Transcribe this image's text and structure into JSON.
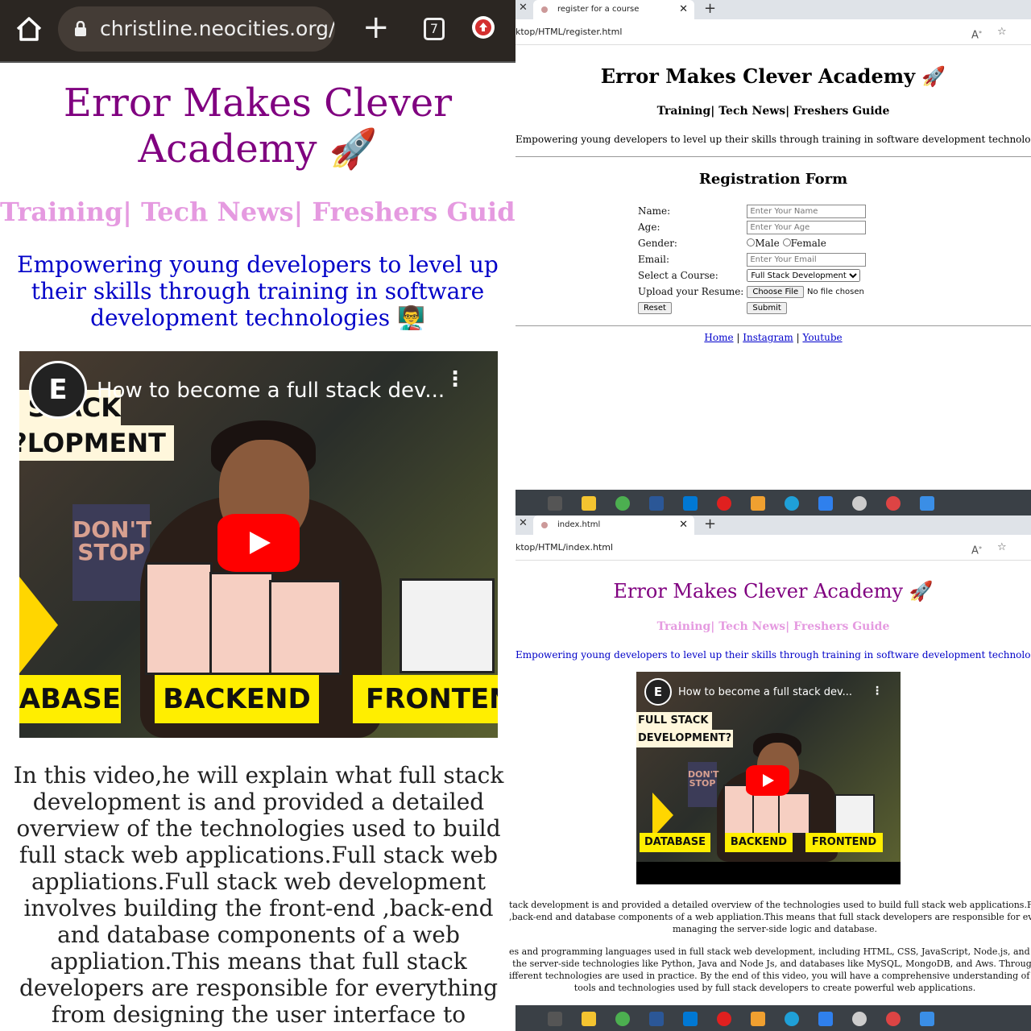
{
  "mobile": {
    "url": "christline.neocities.org/ev",
    "tab_count": "7",
    "title": "Error Makes Clever Academy 🚀",
    "nav": "Training| Tech News| Freshers Guide",
    "tagline": "Empowering young developers to level up their skills through training in software development technologies 👨‍🏫",
    "video": {
      "title": "How to become a full stack dev...",
      "caption_top": "STACK",
      "caption_bottom": "LOPMENT?",
      "labels": [
        "ABASE",
        "BACKEND",
        "FRONTEN"
      ],
      "sign": "DON'T STOP",
      "logo": "E"
    },
    "paragraph": "In this video,he will explain what full stack development is and provided a detailed overview of the technologies used to build full stack web applications.Full stack web appliations.Full stack web development involves building the front-end ,back-end and database components of a web appliation.This means that full stack developers are responsible for everything from designing the user interface to managing the server-side"
  },
  "register_window": {
    "tab_label": "register for a course",
    "address": "ktop/HTML/register.html",
    "title": "Error Makes Clever Academy 🚀",
    "nav": "Training| Tech News| Freshers Guide",
    "tagline": "Empowering young developers to level up their skills through training in software development technologies 👨‍🏫",
    "form_title": "Registration Form",
    "fields": {
      "name_label": "Name:",
      "name_placeholder": "Enter Your Name",
      "age_label": "Age:",
      "age_placeholder": "Enter Your Age",
      "gender_label": "Gender:",
      "male": "Male",
      "female": "Female",
      "email_label": "Email:",
      "email_placeholder": "Enter Your Email",
      "course_label": "Select a Course:",
      "course_value": "Full Stack Development",
      "resume_label": "Upload your Resume:",
      "choose_file": "Choose File",
      "no_file": "No file chosen",
      "reset": "Reset",
      "submit": "Submit"
    },
    "links": [
      "Home",
      "Instagram",
      "Youtube"
    ]
  },
  "index_window": {
    "tab_label": "index.html",
    "address": "ktop/HTML/index.html",
    "title": "Error Makes Clever Academy 🚀",
    "nav": "Training| Tech News| Freshers Guide",
    "tagline": "Empowering young developers to level up their skills through training in software development technologies 👨‍🏫",
    "video": {
      "title": "How to become a full stack dev...",
      "caption_top": "FULL STACK",
      "caption_bottom": "DEVELOPMENT?",
      "labels": [
        "DATABASE",
        "BACKEND",
        "FRONTEND"
      ],
      "sign": "DON'T STOP",
      "logo": "E"
    },
    "paragraph_lines": [
      "tack development is and provided a detailed overview of the technologies used to build full stack web applications.Full",
      ",back-end and database components of a web appliation.This means that full stack developers are responsible for every",
      "managing the server-side logic and database.",
      "es and programming languages used in full stack web development, including HTML, CSS, JavaScript, Node.js, and va",
      "the server-side technologies like Python, Java and Node Js, and databases like MySQL, MongoDB, and Aws. Through",
      "ifferent technologies are used in practice. By the end of this video, you will have a comprehensive understanding of wh",
      "tools and technologies used by full stack developers to create powerful web applications."
    ]
  },
  "colors": {
    "title_purple": "#800080",
    "nav_pink": "#e59ae0",
    "tagline_blue": "#0000c8",
    "youtube_red": "#ff0000",
    "label_yellow": "#ffee00"
  }
}
